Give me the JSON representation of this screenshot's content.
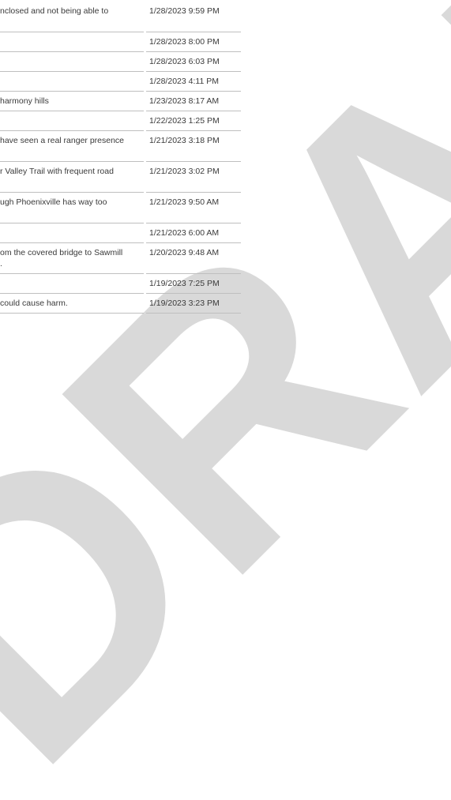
{
  "watermark": {
    "text": "DRAFT",
    "color": "#d9d9d9"
  },
  "comments": [
    {
      "text": [
        "nclosed and not being able to",
        ""
      ],
      "date": "1/28/2023 9:59 PM"
    },
    {
      "text": [
        ""
      ],
      "date": "1/28/2023 8:00 PM"
    },
    {
      "text": [
        ""
      ],
      "date": "1/28/2023 6:03 PM"
    },
    {
      "text": [
        ""
      ],
      "date": "1/28/2023 4:11 PM"
    },
    {
      "text": [
        "harmony hills"
      ],
      "date": "1/23/2023 8:17 AM"
    },
    {
      "text": [
        ""
      ],
      "date": "1/22/2023 1:25 PM"
    },
    {
      "text": [
        "have seen a real ranger presence",
        ""
      ],
      "date": "1/21/2023 3:18 PM"
    },
    {
      "text": [
        "r Valley Trail with frequent road",
        ""
      ],
      "date": "1/21/2023 3:02 PM"
    },
    {
      "text": [
        "ugh Phoenixville has way too",
        ""
      ],
      "date": "1/21/2023 9:50 AM"
    },
    {
      "text": [
        ""
      ],
      "date": "1/21/2023 6:00 AM"
    },
    {
      "text": [
        "om the covered bridge to Sawmill",
        "."
      ],
      "date": "1/20/2023 9:48 AM"
    },
    {
      "text": [
        ""
      ],
      "date": "1/19/2023 7:25 PM"
    },
    {
      "text": [
        " could cause harm."
      ],
      "date": "1/19/2023 3:23 PM"
    }
  ]
}
